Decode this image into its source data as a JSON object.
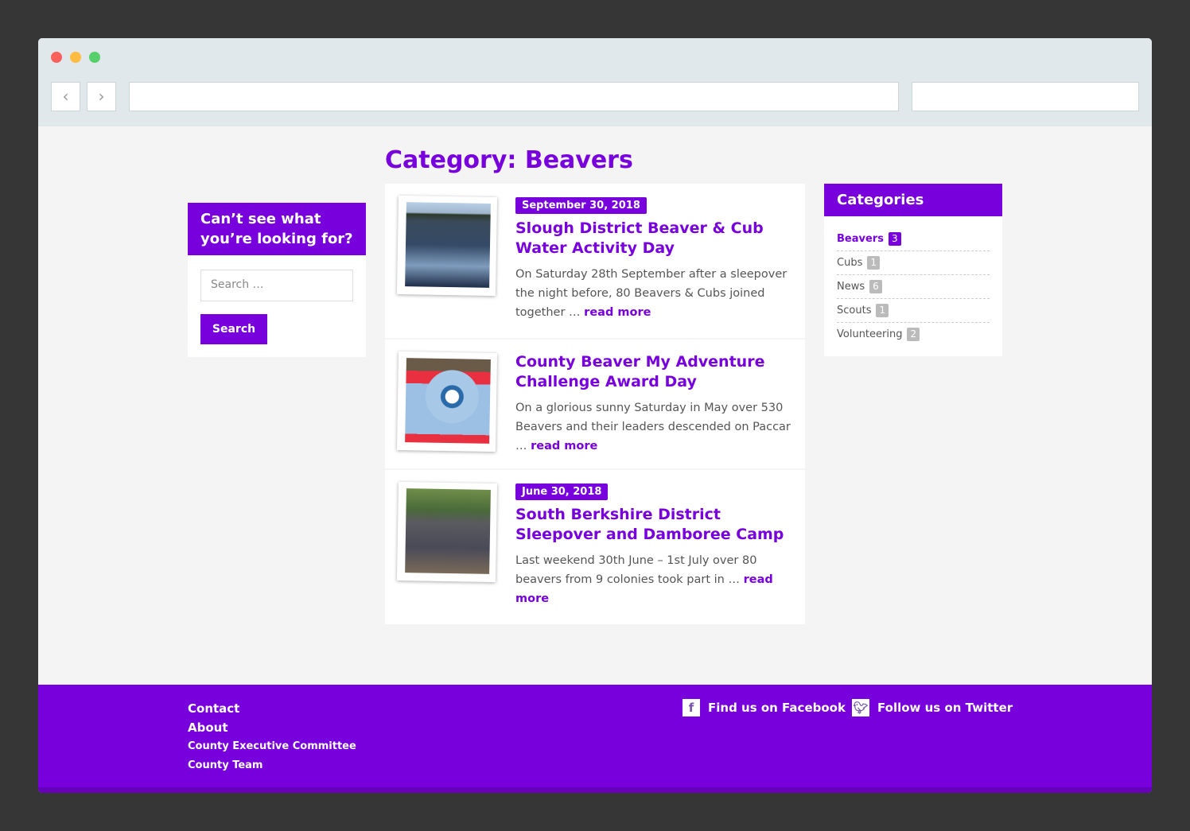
{
  "page": {
    "title": "Category: Beavers"
  },
  "search_widget": {
    "title": "Can’t see what you’re looking for?",
    "placeholder": "Search …",
    "button": "Search"
  },
  "posts": [
    {
      "date": "September 30, 2018",
      "title": "Slough District Beaver & Cub Water Activity Day",
      "excerpt": "On Saturday 28th September after a sleepover the night before, 80 Beavers & Cubs joined together …",
      "read_more": "read more"
    },
    {
      "date": "",
      "title": "County Beaver My Adventure Challenge Award Day",
      "excerpt": "On a glorious sunny Saturday in May over 530 Beavers and their leaders descended on Paccar …",
      "read_more": "read more"
    },
    {
      "date": "June 30, 2018",
      "title": "South Berkshire District Sleepover and Damboree Camp",
      "excerpt": "Last weekend 30th June – 1st July over 80 beavers from 9 colonies took part in …",
      "read_more": "read more"
    }
  ],
  "categories": {
    "title": "Categories",
    "items": [
      {
        "label": "Beavers",
        "count": "3"
      },
      {
        "label": "Cubs",
        "count": "1"
      },
      {
        "label": "News",
        "count": "6"
      },
      {
        "label": "Scouts",
        "count": "1"
      },
      {
        "label": "Volunteering",
        "count": "2"
      }
    ]
  },
  "footer": {
    "links": [
      "Contact",
      "About",
      "County Executive Committee",
      "County Team"
    ],
    "facebook": "Find us on Facebook",
    "twitter": "Follow us on Twitter"
  },
  "colors": {
    "accent": "#7700dd"
  }
}
